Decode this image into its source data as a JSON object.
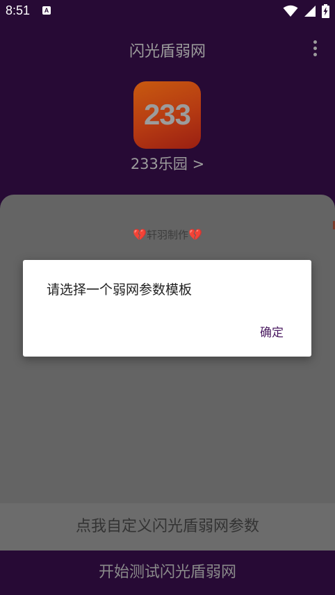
{
  "status_bar": {
    "time": "8:51",
    "notification_icon": "A",
    "icons": [
      "wifi-icon",
      "signal-icon",
      "battery-charging-icon"
    ]
  },
  "app_bar": {
    "title": "闪光盾弱网",
    "overflow_icon": "more-vert-icon"
  },
  "target_app": {
    "logo_text": "233",
    "name": "233乐园 >"
  },
  "card": {
    "credit_heart_left": "💔",
    "credit_text": "轩羽制作",
    "credit_heart_right": "💔"
  },
  "dialog": {
    "message": "请选择一个弱网参数模板",
    "ok_label": "确定"
  },
  "buttons": {
    "custom_label": "点我自定义闪光盾弱网参数",
    "start_label": "开始测试闪光盾弱网"
  },
  "colors": {
    "background": "#270a35",
    "card": "#646464",
    "accent": "#4a1a60"
  }
}
